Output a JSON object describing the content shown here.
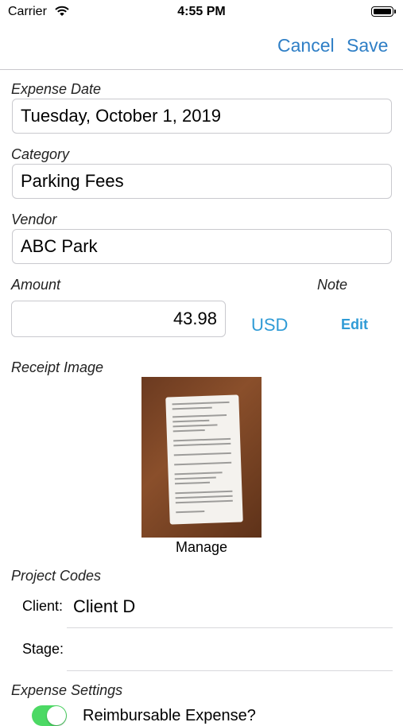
{
  "status_bar": {
    "carrier": "Carrier",
    "time": "4:55 PM"
  },
  "nav": {
    "cancel_label": "Cancel",
    "save_label": "Save"
  },
  "form": {
    "expense_date_label": "Expense Date",
    "expense_date_value": "Tuesday, October 1, 2019",
    "category_label": "Category",
    "category_value": "Parking Fees",
    "vendor_label": "Vendor",
    "vendor_value": "ABC Park",
    "amount_label": "Amount",
    "amount_value": "43.98",
    "currency": "USD",
    "note_label": "Note",
    "note_edit_label": "Edit",
    "receipt_label": "Receipt Image",
    "manage_label": "Manage"
  },
  "project_codes": {
    "section_label": "Project Codes",
    "client_label": "Client:",
    "client_value": "Client D",
    "stage_label": "Stage:"
  },
  "expense_settings": {
    "section_label": "Expense Settings",
    "reimbursable_label": "Reimbursable Expense?",
    "reimbursable_on": true
  },
  "colors": {
    "accent": "#2f7fc6",
    "link": "#2f9bd6",
    "switch_on": "#4cd964"
  }
}
